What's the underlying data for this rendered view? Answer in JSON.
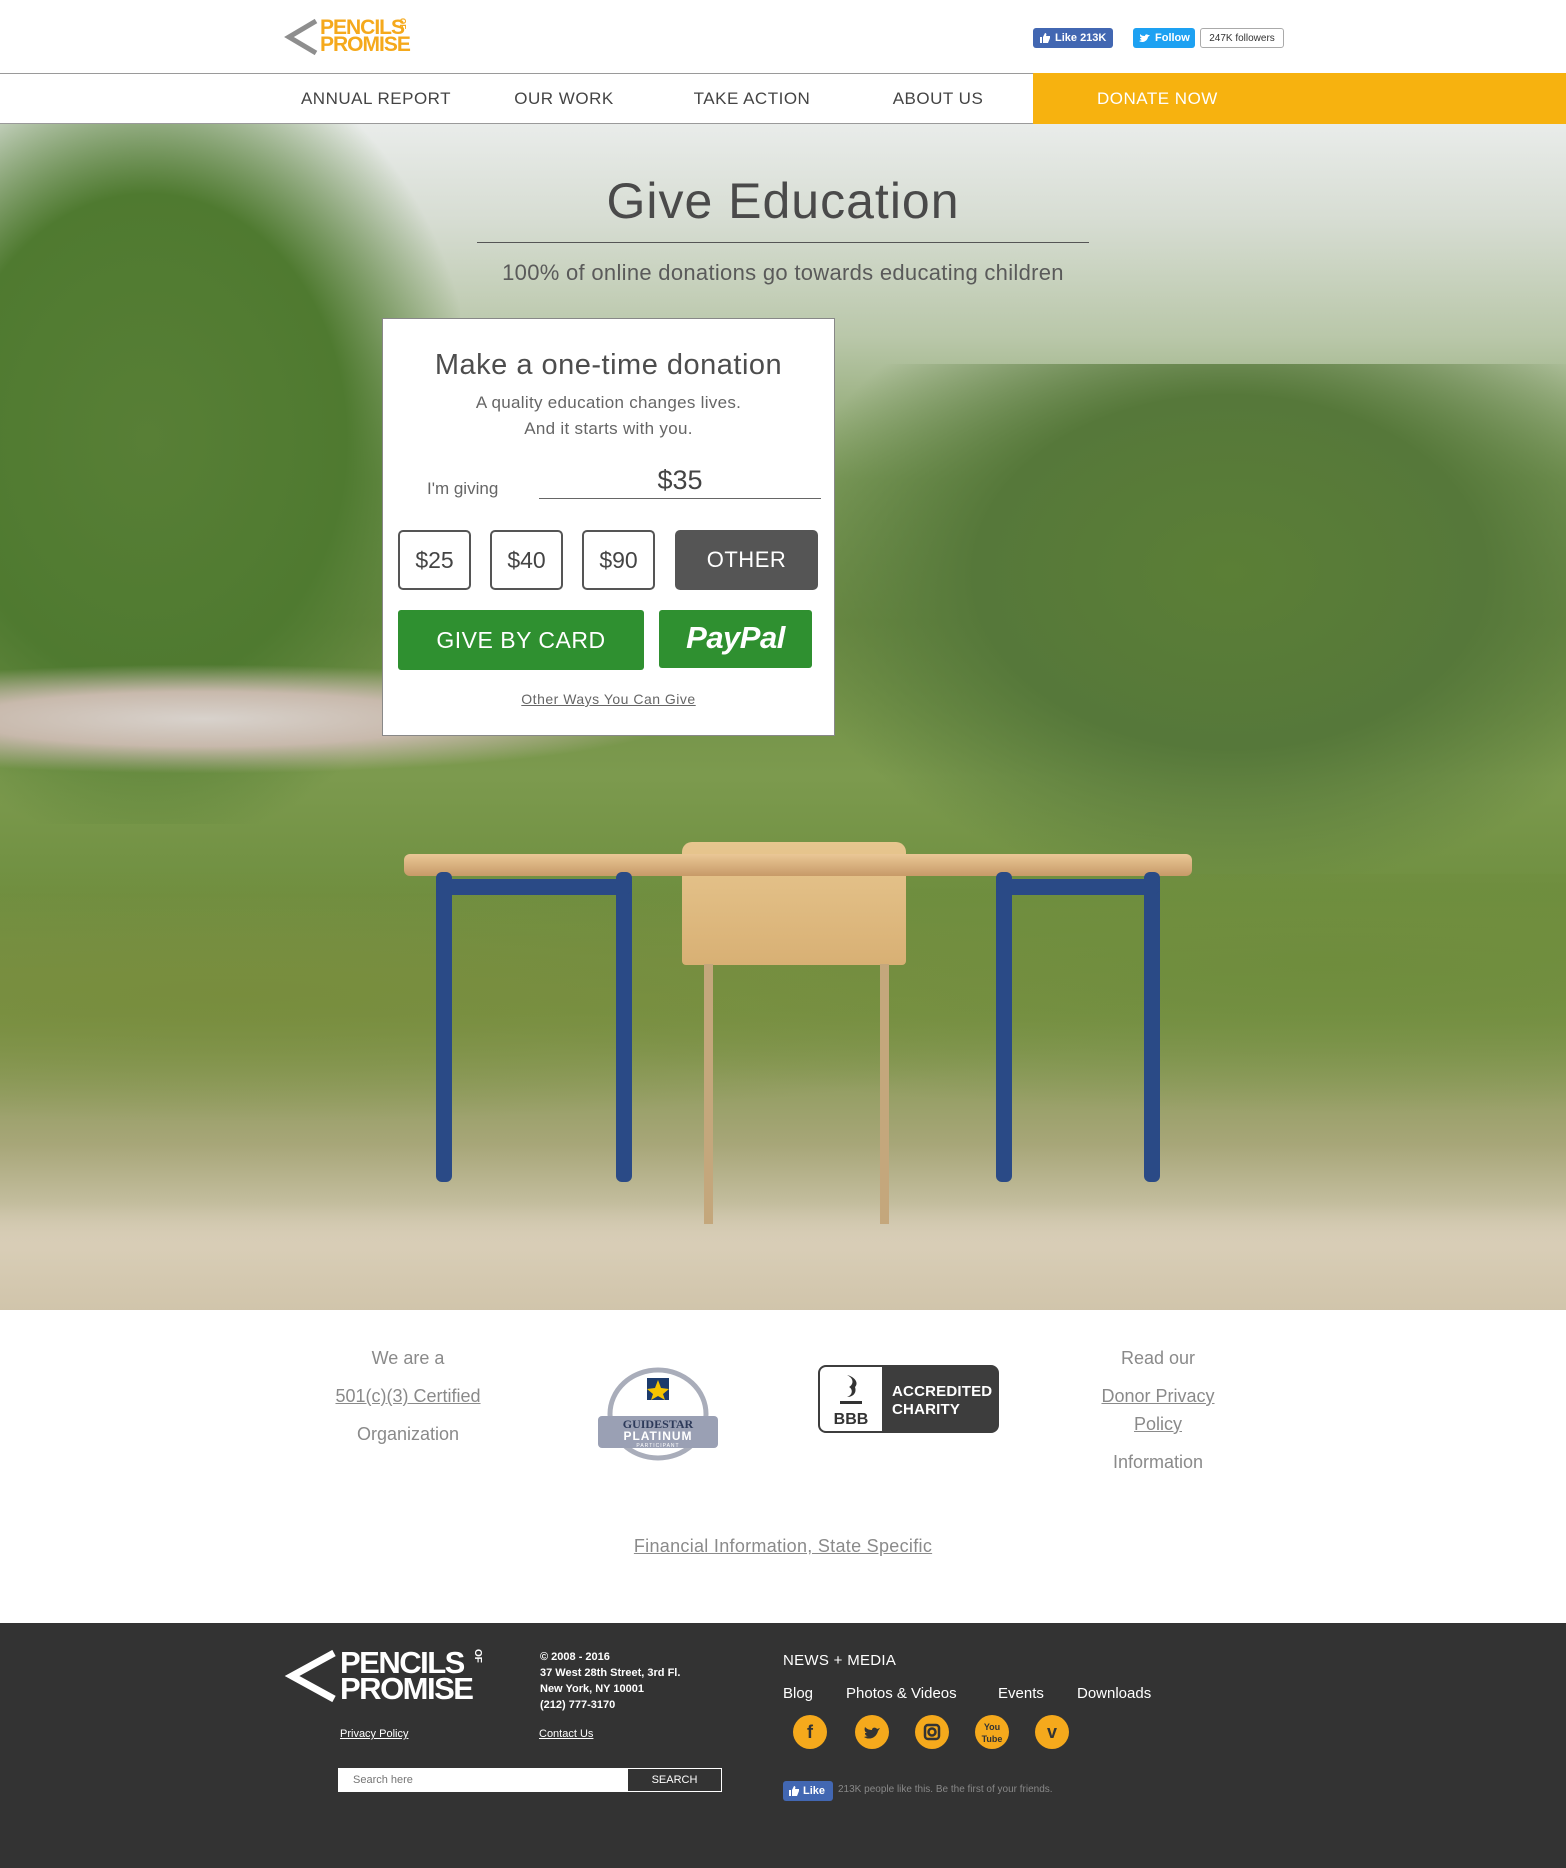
{
  "brand": {
    "logo_line1": "PENCILS",
    "logo_of": "OF",
    "logo_line2": "PROMISE",
    "accent": "#f7b20f",
    "green": "#2f9030"
  },
  "social_header": {
    "fb_like": "Like 213K",
    "tw_follow": "Follow",
    "tw_followers": "247K followers"
  },
  "nav": {
    "items": [
      "ANNUAL REPORT",
      "OUR WORK",
      "TAKE ACTION",
      "ABOUT US"
    ],
    "donate": "DONATE NOW"
  },
  "hero": {
    "title": "Give Education",
    "subtitle": "100% of online donations go towards educating children"
  },
  "donation": {
    "title": "Make a one-time donation",
    "line1": "A quality education changes lives.",
    "line2": "And it starts with you.",
    "giving_label": "I'm giving",
    "amount_value": "$35",
    "amounts": [
      "$25",
      "$40",
      "$90"
    ],
    "other": "OTHER",
    "card_button": "GIVE BY CARD",
    "paypal_button": "PayPal",
    "other_ways": "Other Ways You Can Give"
  },
  "trust": {
    "left_top": "We are a",
    "left_link": "501(c)(3) Certified",
    "left_bottom": "Organization",
    "guidestar_name": "GUIDESTAR",
    "guidestar_level": "PLATINUM",
    "guidestar_sub": "PARTICIPANT",
    "bbb_abbr": "BBB",
    "bbb_line1": "ACCREDITED",
    "bbb_line2": "CHARITY",
    "right_top": "Read our",
    "right_link1": "Donor Privacy",
    "right_link2": "Policy",
    "right_bottom": "Information",
    "financial": "Financial Information, State Specific"
  },
  "footer": {
    "copyright": "© 2008 - 2016",
    "address1": "37 West 28th Street, 3rd Fl.",
    "address2": "New York, NY 10001",
    "phone": "(212) 777-3170",
    "privacy": "Privacy Policy",
    "contact": "Contact Us",
    "search_placeholder": "Search here",
    "search_button": "SEARCH",
    "news_title": "NEWS + MEDIA",
    "news_links": [
      "Blog",
      "Photos & Videos",
      "Events",
      "Downloads"
    ],
    "social_icons": [
      "facebook-icon",
      "twitter-icon",
      "instagram-icon",
      "youtube-icon",
      "vimeo-icon"
    ],
    "fb_like": "Like",
    "fb_like_text": "213K people like this. Be the first of your friends."
  }
}
